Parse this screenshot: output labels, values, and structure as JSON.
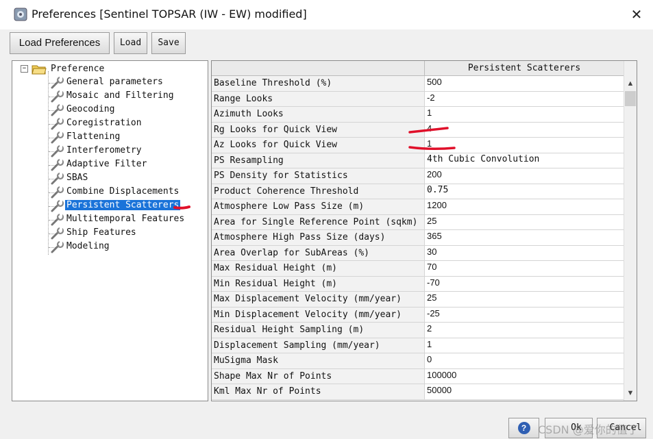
{
  "window": {
    "title": "Preferences [Sentinel TOPSAR (IW - EW) modified]",
    "close_glyph": "✕"
  },
  "toolbar": {
    "load_preferences": "Load Preferences",
    "load": "Load",
    "save": "Save"
  },
  "tree": {
    "root": "Preference",
    "expander": "−",
    "items": [
      {
        "label": "General parameters"
      },
      {
        "label": "Mosaic and Filtering"
      },
      {
        "label": "Geocoding"
      },
      {
        "label": "Coregistration"
      },
      {
        "label": "Flattening"
      },
      {
        "label": "Interferometry"
      },
      {
        "label": "Adaptive Filter"
      },
      {
        "label": "SBAS"
      },
      {
        "label": "Combine Displacements"
      },
      {
        "label": "Persistent Scatterers",
        "selected": true
      },
      {
        "label": "Multitemporal Features"
      },
      {
        "label": "Ship Features"
      },
      {
        "label": "Modeling"
      }
    ]
  },
  "table": {
    "column_header": "Persistent Scatterers",
    "rows": [
      {
        "name": "Baseline Threshold (%)",
        "value": "500"
      },
      {
        "name": "Range Looks",
        "value": "-2"
      },
      {
        "name": "Azimuth Looks",
        "value": "1"
      },
      {
        "name": "Rg Looks for Quick View",
        "value": "4"
      },
      {
        "name": "Az Looks for Quick View",
        "value": "1"
      },
      {
        "name": "PS Resampling",
        "value": "4th Cubic Convolution"
      },
      {
        "name": "PS Density for Statistics",
        "value": "200"
      },
      {
        "name": "Product Coherence Threshold",
        "value": "0.75"
      },
      {
        "name": "Atmosphere Low Pass Size (m)",
        "value": "1200"
      },
      {
        "name": "Area for Single Reference Point (sqkm)",
        "value": "25"
      },
      {
        "name": "Atmosphere High Pass Size (days)",
        "value": "365"
      },
      {
        "name": "Area Overlap for SubAreas (%)",
        "value": "30"
      },
      {
        "name": "Max Residual Height (m)",
        "value": "70"
      },
      {
        "name": "Min Residual Height (m)",
        "value": "-70"
      },
      {
        "name": "Max Displacement Velocity (mm/year)",
        "value": "25"
      },
      {
        "name": "Min Displacement Velocity (mm/year)",
        "value": "-25"
      },
      {
        "name": "Residual Height Sampling (m)",
        "value": "2"
      },
      {
        "name": "Displacement Sampling (mm/year)",
        "value": "1"
      },
      {
        "name": "MuSigma Mask",
        "value": "0"
      },
      {
        "name": "Shape Max Nr of Points",
        "value": "100000"
      },
      {
        "name": "Kml Max Nr of Points",
        "value": "50000"
      }
    ]
  },
  "scrollbar": {
    "up": "▲",
    "down": "▼"
  },
  "footer": {
    "help": "?",
    "ok": "Ok",
    "cancel": "Cancel",
    "watermark": "CSDN @爱你的值了"
  },
  "colors": {
    "selection": "#1a73d9",
    "annotation_red": "#e0102a"
  }
}
